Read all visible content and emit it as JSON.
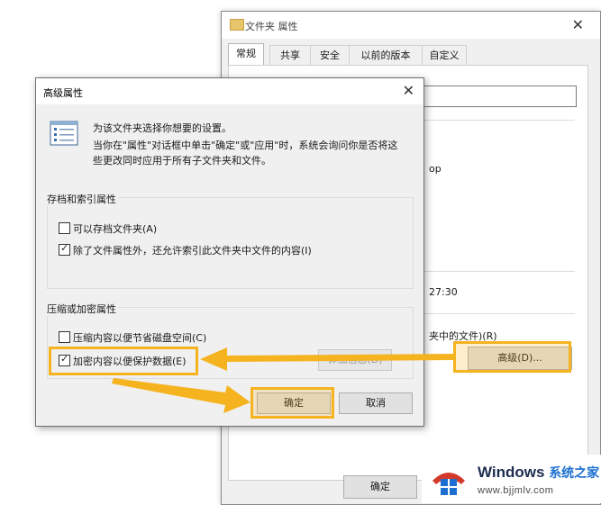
{
  "properties_window": {
    "title": "文件夹 属性",
    "tabs": [
      "常规",
      "共享",
      "安全",
      "以前的版本",
      "自定义"
    ],
    "active_tab": "常规",
    "fragment_op": "op",
    "fragment_time": "27:30",
    "fragment_attr": "夹中的文件)(R)",
    "advanced_button": "高级(D)...",
    "ok_button": "确定"
  },
  "advanced_dialog": {
    "title": "高级属性",
    "desc_line1": "为该文件夹选择你想要的设置。",
    "desc_line2": "当你在\"属性\"对话框中单击\"确定\"或\"应用\"时，系统会询问你是否将这",
    "desc_line3": "些更改同时应用于所有子文件夹和文件。",
    "group1": {
      "label": "存档和索引属性",
      "options": [
        {
          "label": "可以存档文件夹(A)",
          "checked": false
        },
        {
          "label": "除了文件属性外，还允许索引此文件夹中文件的内容(I)",
          "checked": true
        }
      ]
    },
    "group2": {
      "label": "压缩或加密属性",
      "options": [
        {
          "label": "压缩内容以便节省磁盘空间(C)",
          "checked": false
        },
        {
          "label": "加密内容以便保护数据(E)",
          "checked": true
        }
      ],
      "details_button": "详细信息(D)"
    },
    "ok_button": "确定",
    "cancel_button": "取消"
  },
  "annotation_color": "#f5b320",
  "watermark": {
    "brand": "Windows",
    "brand_cn": "系统之家",
    "url": "www.bjjmlv.com"
  }
}
